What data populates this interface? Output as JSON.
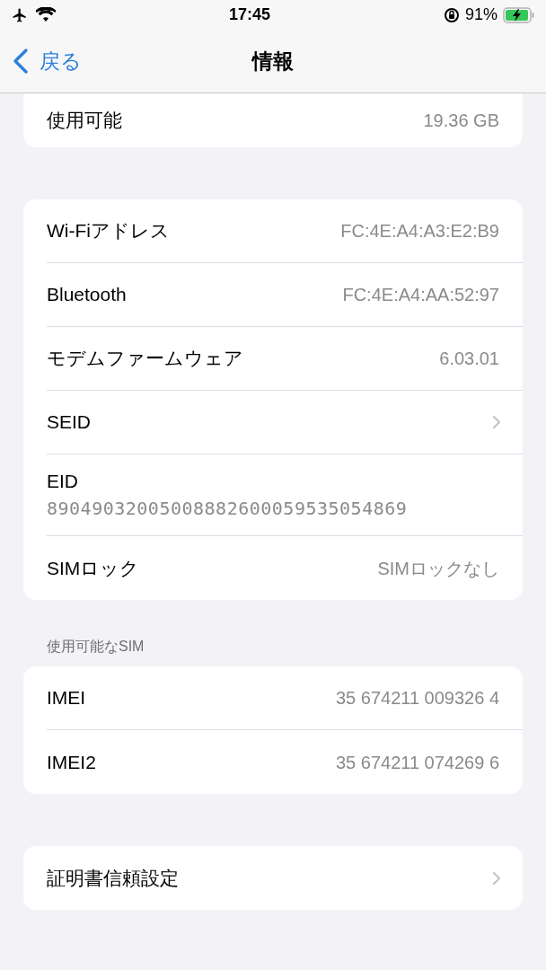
{
  "status_bar": {
    "time": "17:45",
    "battery": "91%"
  },
  "nav": {
    "back": "戻る",
    "title": "情報"
  },
  "sections": [
    {
      "cut_top": true,
      "rows": [
        {
          "kind": "value",
          "label": "使用可能",
          "value": "19.36 GB"
        }
      ]
    },
    {
      "cut_top": false,
      "rows": [
        {
          "kind": "value",
          "label": "Wi-Fiアドレス",
          "value": "FC:4E:A4:A3:E2:B9"
        },
        {
          "kind": "value",
          "label": "Bluetooth",
          "value": "FC:4E:A4:AA:52:97"
        },
        {
          "kind": "value",
          "label": "モデムファームウェア",
          "value": "6.03.01"
        },
        {
          "kind": "link",
          "label": "SEID"
        },
        {
          "kind": "stacked",
          "label": "EID",
          "value": "89049032005008882600059535054869"
        },
        {
          "kind": "value",
          "label": "SIMロック",
          "value": "SIMロックなし"
        }
      ]
    },
    {
      "cut_top": false,
      "header": "使用可能なSIM",
      "rows": [
        {
          "kind": "value",
          "label": "IMEI",
          "value": "35 674211 009326 4"
        },
        {
          "kind": "value",
          "label": "IMEI2",
          "value": "35 674211 074269 6"
        }
      ]
    },
    {
      "cut_top": false,
      "rows": [
        {
          "kind": "link",
          "label": "証明書信頼設定"
        }
      ]
    }
  ]
}
